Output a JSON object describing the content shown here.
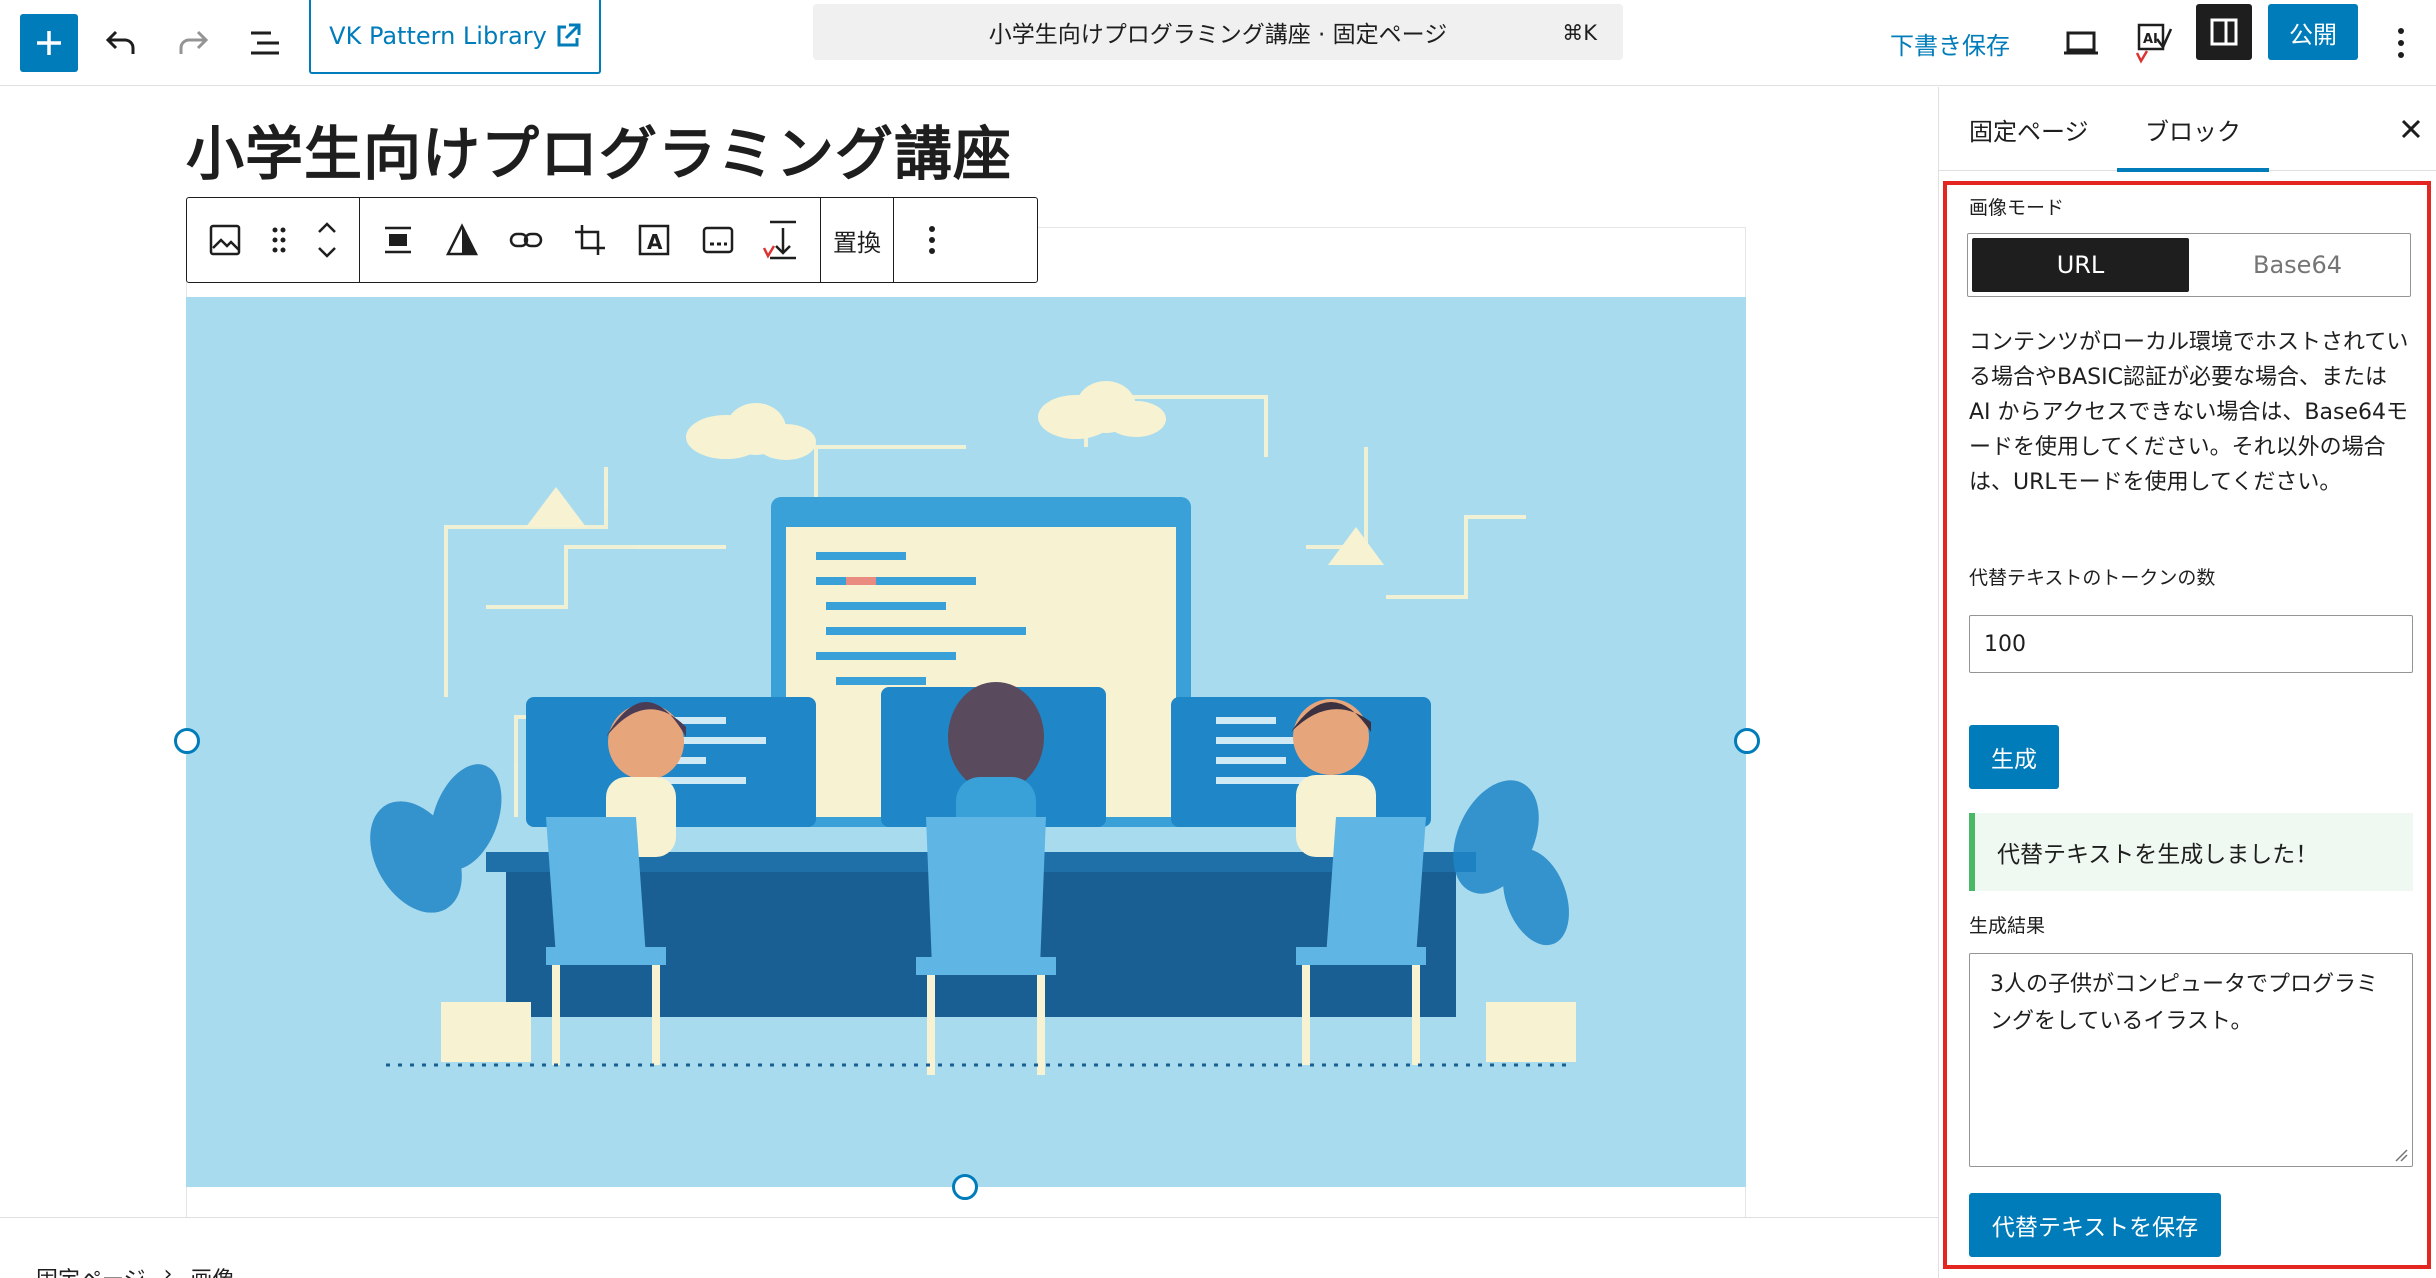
{
  "topbar": {
    "site_link_label": "VK Pattern Library",
    "command_title": "小学生向けプログラミング講座 · 固定ページ",
    "command_shortcut": "⌘K",
    "save_draft_label": "下書き保存",
    "publish_label": "公開"
  },
  "editor": {
    "page_title": "小学生向けプログラミング講座",
    "toolbar_replace_label": "置換"
  },
  "breadcrumb": [
    "固定ページ",
    "›",
    "画像"
  ],
  "sidebar": {
    "tabs": [
      {
        "label": "固定ページ",
        "active": false
      },
      {
        "label": "ブロック",
        "active": true
      }
    ],
    "image_mode_label": "画像モード",
    "mode_options": [
      {
        "label": "URL",
        "selected": true
      },
      {
        "label": "Base64",
        "selected": false
      }
    ],
    "description": "コンテンツがローカル環境でホストされている場合やBASIC認証が必要な場合、または AI からアクセスできない場合は、Base64モードを使用してください。それ以外の場合は、URLモードを使用してください。",
    "token_label": "代替テキストのトークンの数",
    "token_value": "100",
    "generate_label": "生成",
    "notice_text": "代替テキストを生成しました！",
    "result_label": "生成結果",
    "result_text": "3人の子供がコンピュータでプログラミングをしているイラスト。",
    "save_label": "代替テキストを保存"
  },
  "colors": {
    "accent": "#007cba",
    "highlight_border": "#e3261f",
    "success": "#4ab866",
    "illustration_bg": "#a9dbee"
  },
  "icons": [
    "plus-icon",
    "undo-icon",
    "redo-icon",
    "list-view-icon",
    "external-link-icon",
    "desktop-preview-icon",
    "ai-check-icon",
    "sidebar-toggle-icon",
    "more-vertical-icon",
    "close-icon"
  ]
}
